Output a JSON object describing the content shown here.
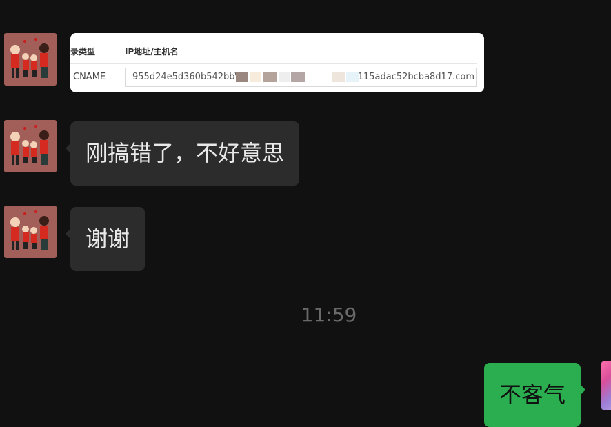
{
  "image_message": {
    "col_record_type": "录类型",
    "col_ip_host": "IP地址/主机名",
    "record_type": "CNAME",
    "value_prefix": "955d24e5d360b542bb\\",
    "value_suffix": "c115adac52bcba8d17.com"
  },
  "messages": [
    {
      "text": "刚搞错了，不好意思"
    },
    {
      "text": "谢谢"
    }
  ],
  "timestamp": "11:59",
  "my_message": {
    "text": "不客气"
  },
  "colors": {
    "background": "#111111",
    "incoming_bubble": "#2c2c2c",
    "outgoing_bubble": "#2bae4f",
    "timestamp": "#6a6a6a"
  }
}
